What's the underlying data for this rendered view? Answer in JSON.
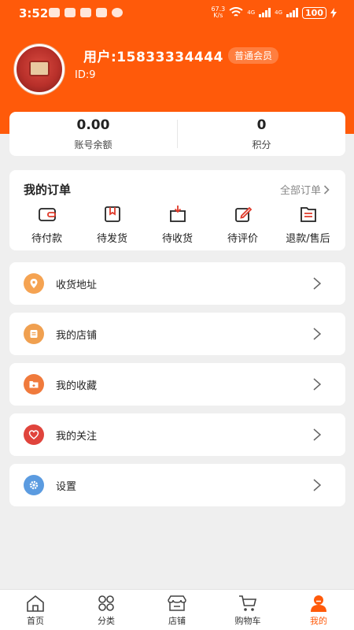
{
  "status_bar": {
    "time": "3:52",
    "net_speed_value": "67.3",
    "net_speed_unit": "K/s",
    "sig1_label": "4G",
    "sig2_label": "4G",
    "battery": "100"
  },
  "profile": {
    "username": "用户:15833334444",
    "member_level": "普通会员",
    "user_id": "ID:9"
  },
  "stats": [
    {
      "value": "0.00",
      "label": "账号余额"
    },
    {
      "value": "0",
      "label": "积分"
    }
  ],
  "orders": {
    "title": "我的订单",
    "all_link": "全部订单",
    "items": [
      {
        "label": "待付款",
        "icon": "wallet-icon"
      },
      {
        "label": "待发货",
        "icon": "box-icon"
      },
      {
        "label": "待收货",
        "icon": "receive-box-icon"
      },
      {
        "label": "待评价",
        "icon": "edit-icon"
      },
      {
        "label": "退款/售后",
        "icon": "list-icon"
      }
    ]
  },
  "menu": [
    {
      "label": "收货地址",
      "icon": "location-icon",
      "color": "#f5a352"
    },
    {
      "label": "我的店铺",
      "icon": "store-icon",
      "color": "#f0a050"
    },
    {
      "label": "我的收藏",
      "icon": "folder-icon",
      "color": "#f07a3c"
    },
    {
      "label": "我的关注",
      "icon": "heart-icon",
      "color": "#e0443c"
    },
    {
      "label": "设置",
      "icon": "gear-icon",
      "color": "#5b9be0"
    }
  ],
  "tabbar": [
    {
      "label": "首页",
      "icon": "home-icon"
    },
    {
      "label": "分类",
      "icon": "category-icon"
    },
    {
      "label": "店铺",
      "icon": "shop-icon"
    },
    {
      "label": "购物车",
      "icon": "cart-icon"
    },
    {
      "label": "我的",
      "icon": "user-icon",
      "active": true
    }
  ],
  "colors": {
    "accent": "#ff5a0a",
    "background": "#efefef"
  }
}
